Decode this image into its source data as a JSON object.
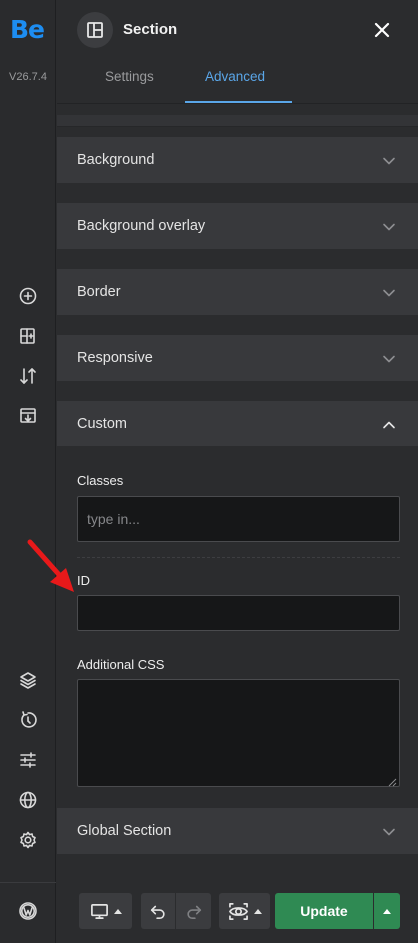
{
  "app": {
    "logo_text": "Be",
    "version": "V26.7.4",
    "accent_color": "#1d8df1"
  },
  "rail": {
    "top_icons": [
      "add-element-icon",
      "layout-add-icon",
      "sort-arrows-icon",
      "import-icon"
    ],
    "bottom_icons": [
      "layers-icon",
      "revisions-icon",
      "sliders-icon",
      "globe-icon",
      "settings-icon",
      "wordpress-icon"
    ]
  },
  "header": {
    "title": "Section",
    "icon": "section-layout-icon",
    "close_icon": "close-icon",
    "tabs": [
      {
        "label": "Settings",
        "active": false
      },
      {
        "label": "Advanced",
        "active": true
      }
    ]
  },
  "accordions": [
    {
      "label": "Background",
      "open": false
    },
    {
      "label": "Background overlay",
      "open": false
    },
    {
      "label": "Border",
      "open": false
    },
    {
      "label": "Responsive",
      "open": false
    },
    {
      "label": "Custom",
      "open": true
    },
    {
      "label": "Global Section",
      "open": false
    }
  ],
  "custom": {
    "classes_label": "Classes",
    "classes_placeholder": "type in...",
    "classes_value": "",
    "id_label": "ID",
    "id_value": "",
    "css_label": "Additional CSS",
    "css_value": ""
  },
  "annotation": {
    "type": "red-arrow",
    "color": "#e8191a",
    "target": "id-field"
  },
  "toolbar": {
    "device_icon": "desktop-icon",
    "undo_icon": "undo-icon",
    "redo_icon": "redo-icon",
    "preview_icon": "preview-eye-icon",
    "update_label": "Update",
    "update_color": "#2f8a53"
  }
}
